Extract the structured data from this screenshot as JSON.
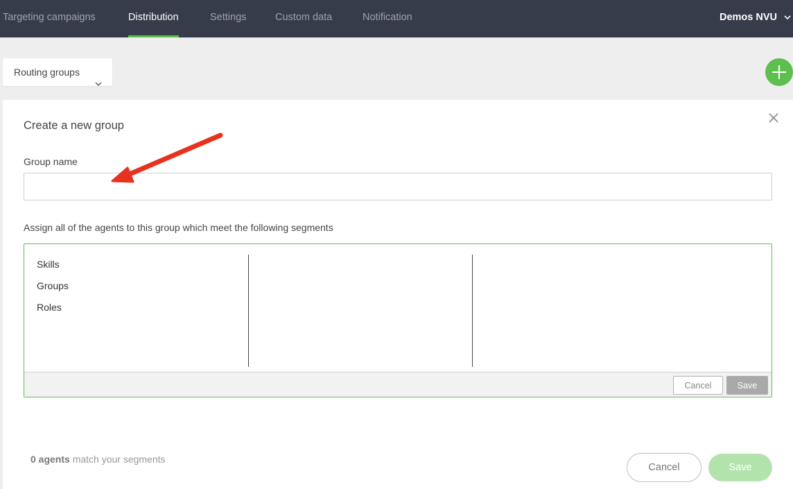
{
  "nav": {
    "tabs": [
      {
        "label": "Targeting campaigns",
        "active": false
      },
      {
        "label": "Distribution",
        "active": true
      },
      {
        "label": "Settings",
        "active": false
      },
      {
        "label": "Custom data",
        "active": false
      },
      {
        "label": "Notification",
        "active": false
      }
    ],
    "account": "Demos NVU"
  },
  "toolbar": {
    "view_selector": "Routing groups",
    "add_icon": "plus-icon"
  },
  "panel": {
    "title": "Create a new group",
    "group_name_label": "Group name",
    "group_name_value": "",
    "segments_label": "Assign all of the agents to this group which meet the following segments",
    "segment_categories": [
      "Skills",
      "Groups",
      "Roles"
    ],
    "segment_cancel": "Cancel",
    "segment_save": "Save",
    "agents_count": "0 agents",
    "agents_suffix": " match your segments",
    "cancel": "Cancel",
    "save": "Save"
  },
  "colors": {
    "nav_bg": "#363c4a",
    "accent": "#5dc04e",
    "annotation_arrow": "#e8321f"
  }
}
